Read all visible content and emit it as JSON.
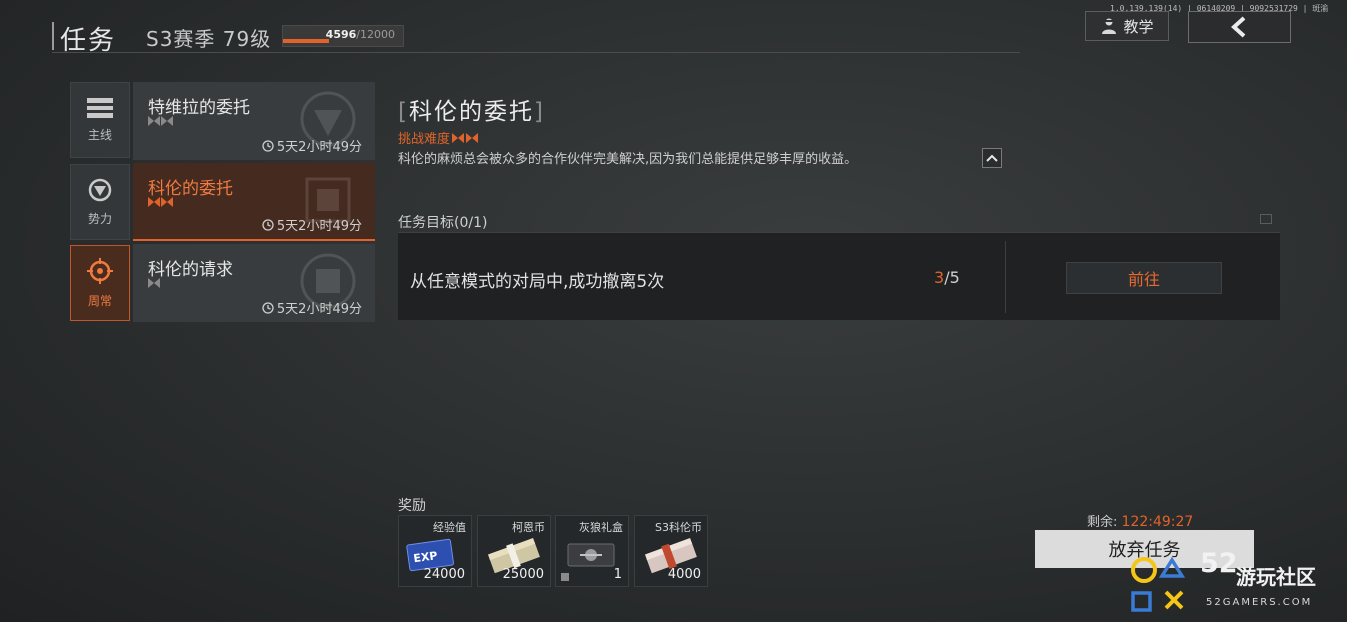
{
  "header": {
    "title": "任务",
    "season": "S3赛季",
    "level": "79级",
    "xp_current": "4596",
    "xp_max": "/12000",
    "xp_progress": 0.383,
    "version": "1.0.139.139(14) | 06140209 | 9092531729 | 斑渝",
    "teach_label": "教学"
  },
  "categories": [
    {
      "label": "主线",
      "icon": "list-icon"
    },
    {
      "label": "势力",
      "icon": "faction-icon"
    },
    {
      "label": "周常",
      "icon": "crosshair-icon"
    }
  ],
  "quests": [
    {
      "name": "特维拉的委托",
      "time": "5天2小时49分"
    },
    {
      "name": "科伦的委托",
      "time": "5天2小时49分"
    },
    {
      "name": "科伦的请求",
      "time": "5天2小时49分"
    }
  ],
  "detail": {
    "title": "科伦的委托",
    "difficulty_label": "挑战难度",
    "description": "科伦的麻烦总会被众多的合作伙伴完美解决,因为我们总能提供足够丰厚的收益。",
    "objective_label": "任务目标(0/1)",
    "objective_text": "从任意模式的对局中,成功撤离5次",
    "progress_current": "3",
    "progress_total": "/5",
    "go_label": "前往"
  },
  "rewards": {
    "label": "奖励",
    "items": [
      {
        "name": "经验值",
        "value": "24000"
      },
      {
        "name": "柯恩币",
        "value": "25000"
      },
      {
        "name": "灰狼礼盒",
        "value": "1"
      },
      {
        "name": "S3科伦币",
        "value": "4000"
      }
    ]
  },
  "footer": {
    "remaining_label": "剩余:",
    "remaining_time": "122:49:27",
    "abandon_label": "放弃任务"
  },
  "watermark": {
    "number": "52",
    "name": "游玩社区",
    "url": "52GAMERS.COM"
  },
  "colors": {
    "accent": "#e0642a",
    "accent_bg": "#452a20",
    "panel": "#393c3e"
  }
}
